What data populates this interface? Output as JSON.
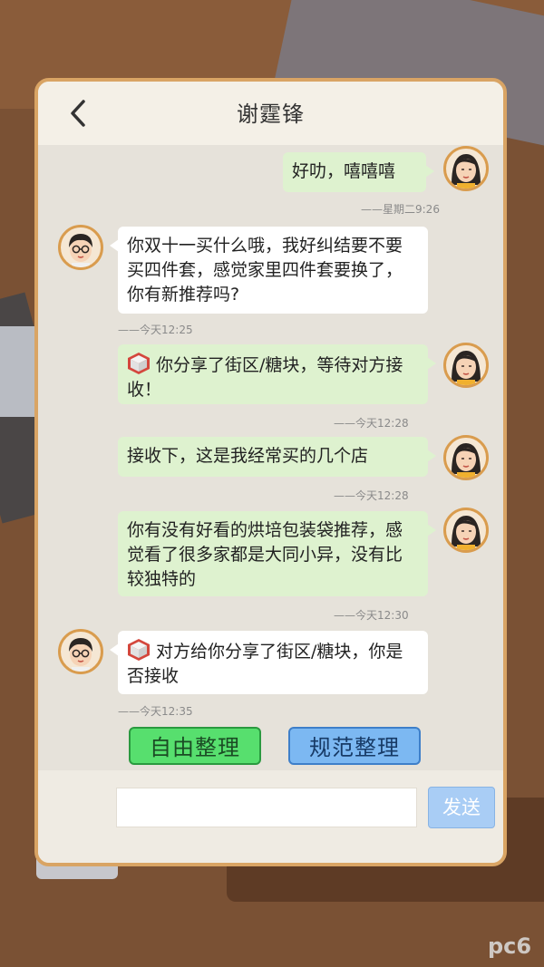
{
  "header": {
    "title": "谢霆锋"
  },
  "messages": [
    {
      "text": "好叻，嘻嘻嘻",
      "time": "——星期二9:26"
    },
    {
      "text": "你双十一买什么哦，我好纠结要不要买四件套，感觉家里四件套要换了，你有新推荐吗?",
      "time": "——今天12:25"
    },
    {
      "text": "你分享了街区/糖块，等待对方接收！",
      "time": "——今天12:28"
    },
    {
      "text": "接收下，这是我经常买的几个店",
      "time": "——今天12:28"
    },
    {
      "text": "你有没有好看的烘培包装袋推荐，感觉看了很多家都是大同小异，没有比较独特的",
      "time": "——今天12:30"
    },
    {
      "text": "对方给你分享了街区/糖块，你是否接收",
      "time": "——今天12:35"
    }
  ],
  "actions": {
    "free_label": "自由整理",
    "norm_label": "规范整理"
  },
  "input": {
    "value": "",
    "send_label": "发送"
  },
  "watermark": "pc6",
  "colors": {
    "panel_border": "#d9a464",
    "green_bubble": "#def2cf",
    "free_btn": "#57df6e",
    "norm_btn": "#7cb8f2",
    "send_btn": "#a9cdf5"
  }
}
